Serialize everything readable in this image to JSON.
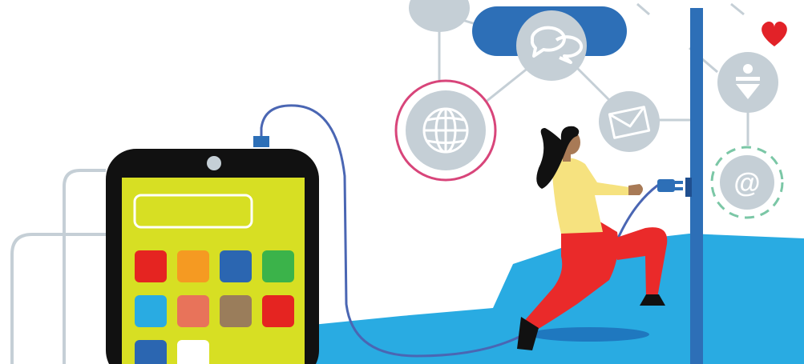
{
  "illustration": {
    "colors": {
      "background": "#ffffff",
      "floor": "#29abe2",
      "floor_shadow": "#1f78bf",
      "wall": "#2d6fb7",
      "node_gray": "#c5cfd6",
      "node_icon": "#ffffff",
      "line_gray": "#c5cfd6",
      "globe_ring": "#d8457a",
      "at_ring": "#7bc7a6",
      "cloud": "#2d6fb7",
      "heart": "#e22228",
      "cable": "#4a66b3",
      "phone_body": "#111111",
      "phone_screen": "#d7df23",
      "shirt": "#f6e27f",
      "pants": "#ea2a2a",
      "skin": "#a87a56",
      "hair": "#111111"
    },
    "phone": {
      "app_tiles": [
        {
          "color": "#e52421"
        },
        {
          "color": "#f59a22"
        },
        {
          "color": "#2b66b1"
        },
        {
          "color": "#3bb34a"
        },
        {
          "color": "#29abe2"
        },
        {
          "color": "#e8735a"
        },
        {
          "color": "#9a7d5b"
        },
        {
          "color": "#e52421"
        },
        {
          "color": "#2b66b1"
        },
        {
          "color": "#ffffff"
        }
      ]
    },
    "nodes": [
      {
        "icon": "speech-bubbles-icon"
      },
      {
        "icon": "globe-icon"
      },
      {
        "icon": "envelope-icon"
      },
      {
        "icon": "user-download-icon"
      },
      {
        "icon": "at-sign-icon",
        "label": "@"
      },
      {
        "icon": "heart-icon"
      }
    ]
  }
}
